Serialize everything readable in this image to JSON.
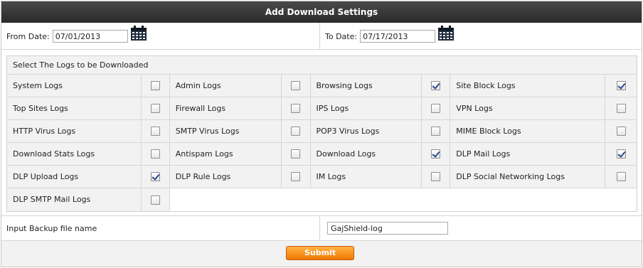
{
  "title": "Add Download Settings",
  "dates": {
    "from_label": "From Date:",
    "from_value": "07/01/2013",
    "to_label": "To Date:",
    "to_value": "07/17/2013"
  },
  "logs": {
    "header": "Select The Logs to be Downloaded",
    "rows": [
      [
        {
          "label": "System Logs",
          "checked": false
        },
        {
          "label": "Admin Logs",
          "checked": false
        },
        {
          "label": "Browsing Logs",
          "checked": true
        },
        {
          "label": "Site Block Logs",
          "checked": true
        }
      ],
      [
        {
          "label": "Top Sites Logs",
          "checked": false
        },
        {
          "label": "Firewall Logs",
          "checked": false
        },
        {
          "label": "IPS Logs",
          "checked": false
        },
        {
          "label": "VPN Logs",
          "checked": false
        }
      ],
      [
        {
          "label": "HTTP Virus Logs",
          "checked": false
        },
        {
          "label": "SMTP Virus Logs",
          "checked": false
        },
        {
          "label": "POP3 Virus Logs",
          "checked": false
        },
        {
          "label": "MIME Block Logs",
          "checked": false
        }
      ],
      [
        {
          "label": "Download Stats Logs",
          "checked": false
        },
        {
          "label": "Antispam Logs",
          "checked": false
        },
        {
          "label": "Download Logs",
          "checked": true
        },
        {
          "label": "DLP Mail Logs",
          "checked": true
        }
      ],
      [
        {
          "label": "DLP Upload Logs",
          "checked": true
        },
        {
          "label": "DLP Rule Logs",
          "checked": false
        },
        {
          "label": "IM Logs",
          "checked": false
        },
        {
          "label": "DLP Social Networking Logs",
          "checked": false
        }
      ],
      [
        {
          "label": "DLP SMTP Mail Logs",
          "checked": false
        }
      ]
    ]
  },
  "backup": {
    "label": "Input Backup file name",
    "value": "GajShield-log"
  },
  "submit_label": "Submit",
  "icons": {
    "calendar": "calendar-icon"
  },
  "colors": {
    "title_bar": "#333333",
    "submit": "#f07800",
    "check": "#2a4d8f"
  }
}
